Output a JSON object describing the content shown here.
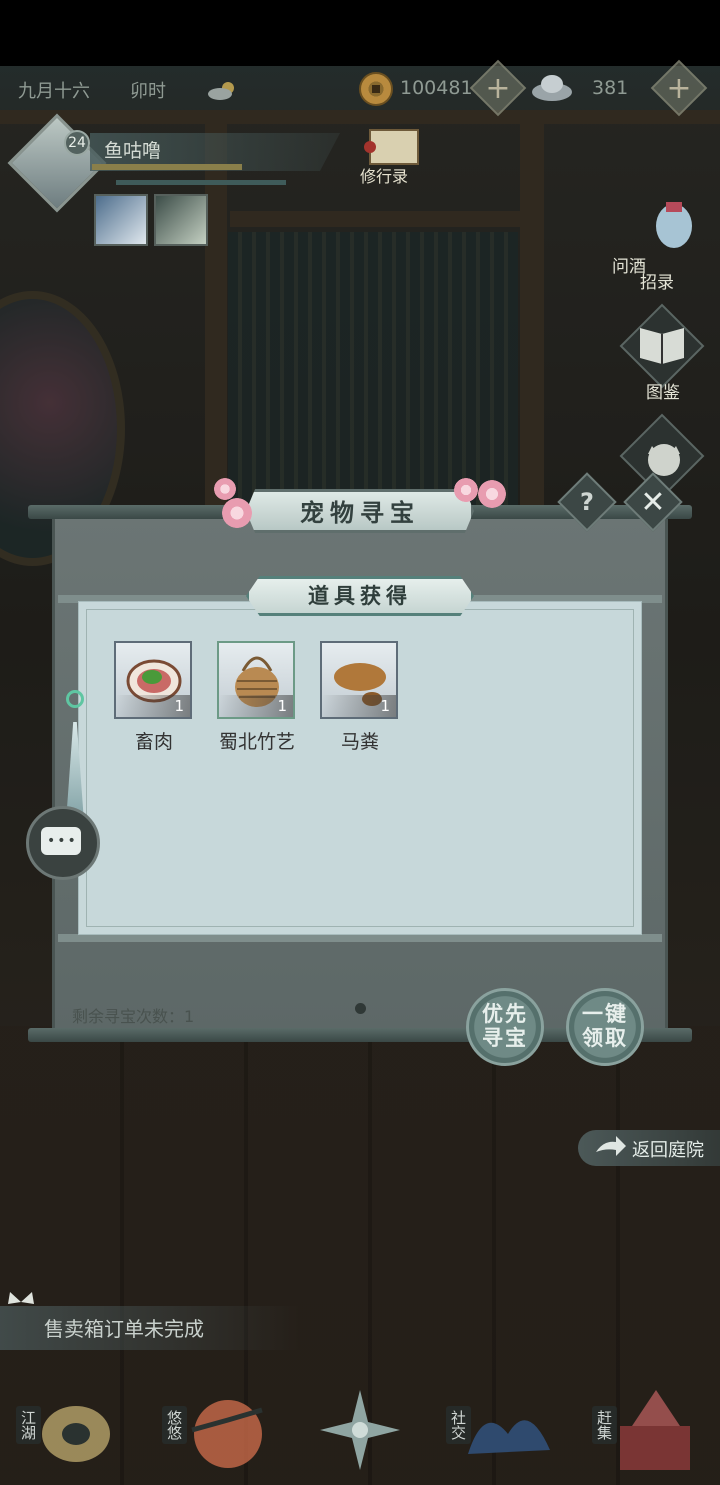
{
  "status_bar": {
    "date": "九月十六",
    "time_of_day": "卯时",
    "weather_icon": "cloud-sun-icon",
    "coins": "100481",
    "silver": "381"
  },
  "player": {
    "level": "24",
    "name": "鱼咕噜"
  },
  "shortcuts": {
    "xiuxing": "修行录",
    "wenjiu_line1": "问酒",
    "wenjiu_line2": "招录",
    "tujian": "图鉴"
  },
  "dialog": {
    "title": "宠物寻宝",
    "help_label": "?",
    "close_label": "✕",
    "reward_title": "道具获得",
    "items": [
      {
        "name": "畜肉",
        "count": "1",
        "icon": "meat-icon"
      },
      {
        "name": "蜀北竹艺",
        "count": "1",
        "icon": "bamboo-basket-icon"
      },
      {
        "name": "马粪",
        "count": "1",
        "icon": "manure-icon"
      }
    ],
    "remaining_label": "剩余寻宝次数：1",
    "priority_button": {
      "line1": "优先",
      "line2": "寻宝"
    },
    "collect_button": {
      "line1": "一键",
      "line2": "领取"
    }
  },
  "return_courtyard": "返回庭院",
  "notice": "售卖箱订单未完成",
  "bottom_nav": [
    {
      "label": "江湖"
    },
    {
      "label": "悠悠"
    },
    {
      "label": "社交"
    },
    {
      "label": "赶集"
    }
  ],
  "colors": {
    "panel_bg": "#c7d8da",
    "dialog_bg": "#6b7574",
    "accent_green": "#5fc6a2"
  }
}
